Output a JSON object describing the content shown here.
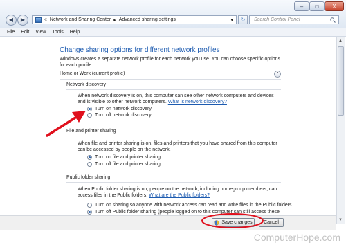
{
  "window": {
    "minimize_glyph": "–",
    "maximize_glyph": "□",
    "close_glyph": "X"
  },
  "address": {
    "separator": "«",
    "crumbs": [
      "Network and Sharing Center",
      "Advanced sharing settings"
    ],
    "crumb_arrow": "▸",
    "dropdown_glyph": "▾"
  },
  "search": {
    "placeholder": "Search Control Panel"
  },
  "menu": [
    "File",
    "Edit",
    "View",
    "Tools",
    "Help"
  ],
  "page": {
    "title": "Change sharing options for different network profiles",
    "intro": "Windows creates a separate network profile for each network you use. You can choose specific options for each profile.",
    "profile": {
      "label": "Home or Work (current profile)",
      "toggle_glyph": "⌃"
    },
    "network_discovery": {
      "heading": "Network discovery",
      "text": "When network discovery is on, this computer can see other network computers and devices and is visible to other network computers.",
      "link": "What is network discovery?",
      "options": [
        {
          "label": "Turn on network discovery",
          "selected": true
        },
        {
          "label": "Turn off network discovery",
          "selected": false
        }
      ]
    },
    "file_printer": {
      "heading": "File and printer sharing",
      "text": "When file and printer sharing is on, files and printers that you have shared from this computer can be accessed by people on the network.",
      "options": [
        {
          "label": "Turn on file and printer sharing",
          "selected": true
        },
        {
          "label": "Turn off file and printer sharing",
          "selected": false
        }
      ]
    },
    "public_folder": {
      "heading": "Public folder sharing",
      "text": "When Public folder sharing is on, people on the network, including homegroup members, can access files in the Public folders.",
      "link": "What are the Public folders?",
      "options": [
        {
          "label": "Turn on sharing so anyone with network access can read and write files in the Public folders",
          "selected": false
        },
        {
          "label": "Turn off Public folder sharing (people logged on to this computer can still access these",
          "selected": true
        }
      ]
    }
  },
  "footer": {
    "save_label": "Save changes",
    "cancel_label": "Cancel"
  },
  "watermark": "ComputerHope.com",
  "colors": {
    "accent": "#1d5bb0",
    "annotation": "#e0101d"
  }
}
